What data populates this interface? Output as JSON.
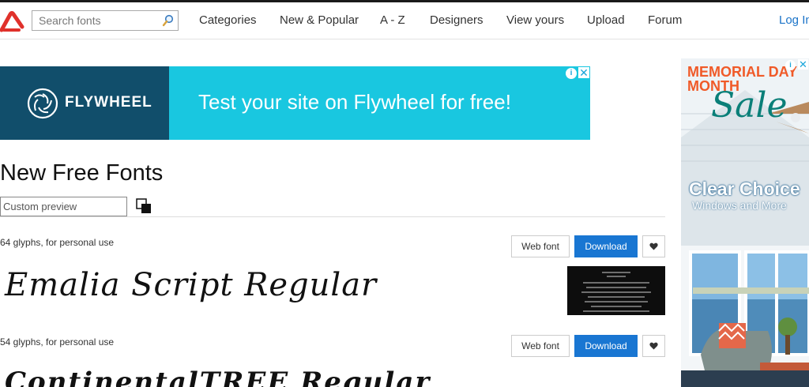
{
  "header": {
    "search": {
      "placeholder": "Search fonts",
      "value": ""
    },
    "nav": [
      "Categories",
      "New & Popular",
      "A - Z",
      "Designers",
      "View yours",
      "Upload",
      "Forum"
    ],
    "login": "Log In"
  },
  "ad_banner": {
    "brand": "FLYWHEEL",
    "tagline": "Test your site on Flywheel for free!"
  },
  "side_ad": {
    "headline": "MEMORIAL DAY MONTH",
    "script": "Sale",
    "brand": "Clear Choice",
    "brand_sub": "Windows and More"
  },
  "main": {
    "title": "New Free Fonts",
    "custom_preview": {
      "placeholder": "Custom preview",
      "value": ""
    },
    "fonts": [
      {
        "meta": "64 glyphs, for personal use",
        "web_font_label": "Web font",
        "download_label": "Download",
        "sample_text": "Emalia Script Regular"
      },
      {
        "meta": "54 glyphs, for personal use",
        "web_font_label": "Web font",
        "download_label": "Download",
        "sample_text": "ContinentalTREE Regular"
      }
    ]
  },
  "colors": {
    "accent": "#1976d2",
    "logo_red": "#e0312b",
    "ad_cyan": "#19c7e0",
    "ad_navy": "#114e6b"
  },
  "icons": [
    "brand-logo-icon",
    "search-icon",
    "flywheel-logo-icon",
    "ad-info-icon",
    "ad-close-icon",
    "color-toggle-icon",
    "heart-icon"
  ]
}
